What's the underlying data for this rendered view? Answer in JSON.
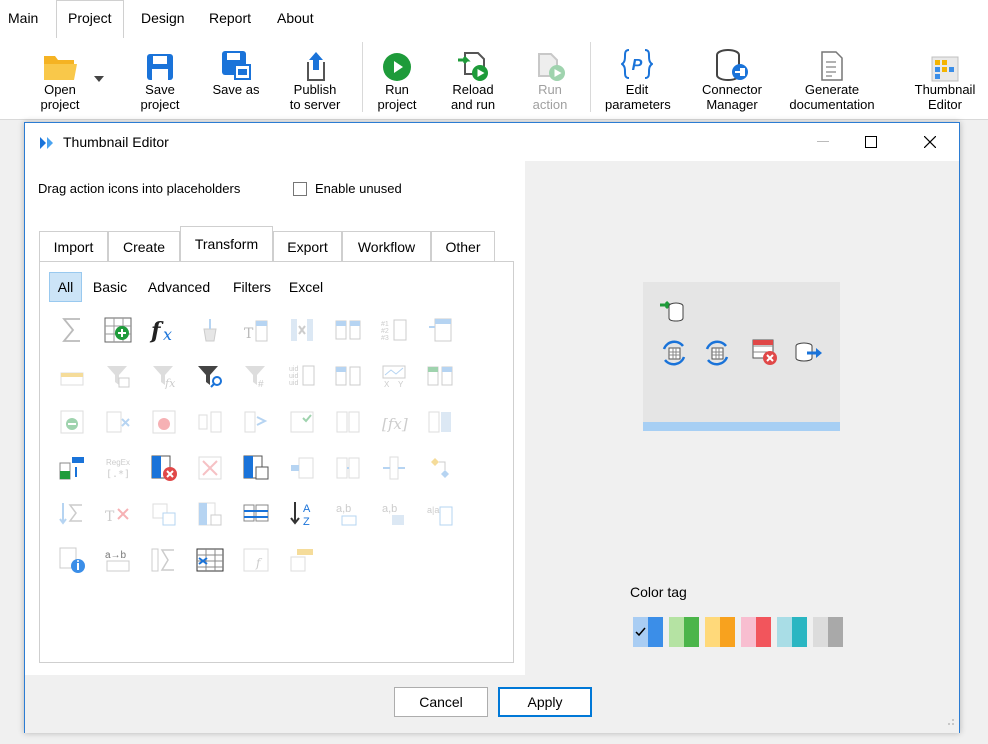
{
  "menu": {
    "tabs": [
      "Main",
      "Project",
      "Design",
      "Report",
      "About"
    ],
    "active": "Project"
  },
  "ribbon": {
    "buttons": [
      {
        "label": "Open\nproject",
        "icon": "folder-open-icon",
        "enabled": true
      },
      {
        "label": "Save\nproject",
        "icon": "floppy-disk-icon",
        "enabled": true
      },
      {
        "label": "Save as",
        "icon": "floppy-disk-as-icon",
        "enabled": true
      },
      {
        "label": "Publish\nto server",
        "icon": "publish-upload-icon",
        "enabled": true
      },
      {
        "label": "Run\nproject",
        "icon": "play-icon",
        "enabled": true
      },
      {
        "label": "Reload\nand run",
        "icon": "reload-run-icon",
        "enabled": true
      },
      {
        "label": "Run\naction",
        "icon": "run-action-icon",
        "enabled": false
      },
      {
        "label": "Edit\nparameters",
        "icon": "parameters-icon",
        "enabled": true
      },
      {
        "label": "Connector\nManager",
        "icon": "database-connector-icon",
        "enabled": true
      },
      {
        "label": "Generate\ndocumentation",
        "icon": "document-icon",
        "enabled": true
      },
      {
        "label": "Thumbnail\nEditor",
        "icon": "thumbnail-icon",
        "enabled": true
      }
    ]
  },
  "dialog": {
    "title": "Thumbnail Editor",
    "hint": "Drag action icons into placeholders",
    "enable_unused_label": "Enable unused",
    "tabs": [
      "Import",
      "Create",
      "Transform",
      "Export",
      "Workflow",
      "Other"
    ],
    "active_tab": "Transform",
    "subtabs": [
      "All",
      "Basic",
      "Advanced",
      "Filters",
      "Excel"
    ],
    "active_subtab": "All",
    "color_tag_label": "Color tag",
    "color_tags": [
      {
        "light": "#a9cdf3",
        "dark": "#3b8ee8",
        "selected": true
      },
      {
        "light": "#b5e3a3",
        "dark": "#4bb54a",
        "selected": false
      },
      {
        "light": "#ffd97a",
        "dark": "#f8a21e",
        "selected": false
      },
      {
        "light": "#f8bed0",
        "dark": "#f2555c",
        "selected": false
      },
      {
        "light": "#a9dde6",
        "dark": "#2ab6c2",
        "selected": false
      },
      {
        "light": "#dcdcdc",
        "dark": "#a9a9a9",
        "selected": false
      }
    ],
    "cancel_label": "Cancel",
    "apply_label": "Apply"
  }
}
